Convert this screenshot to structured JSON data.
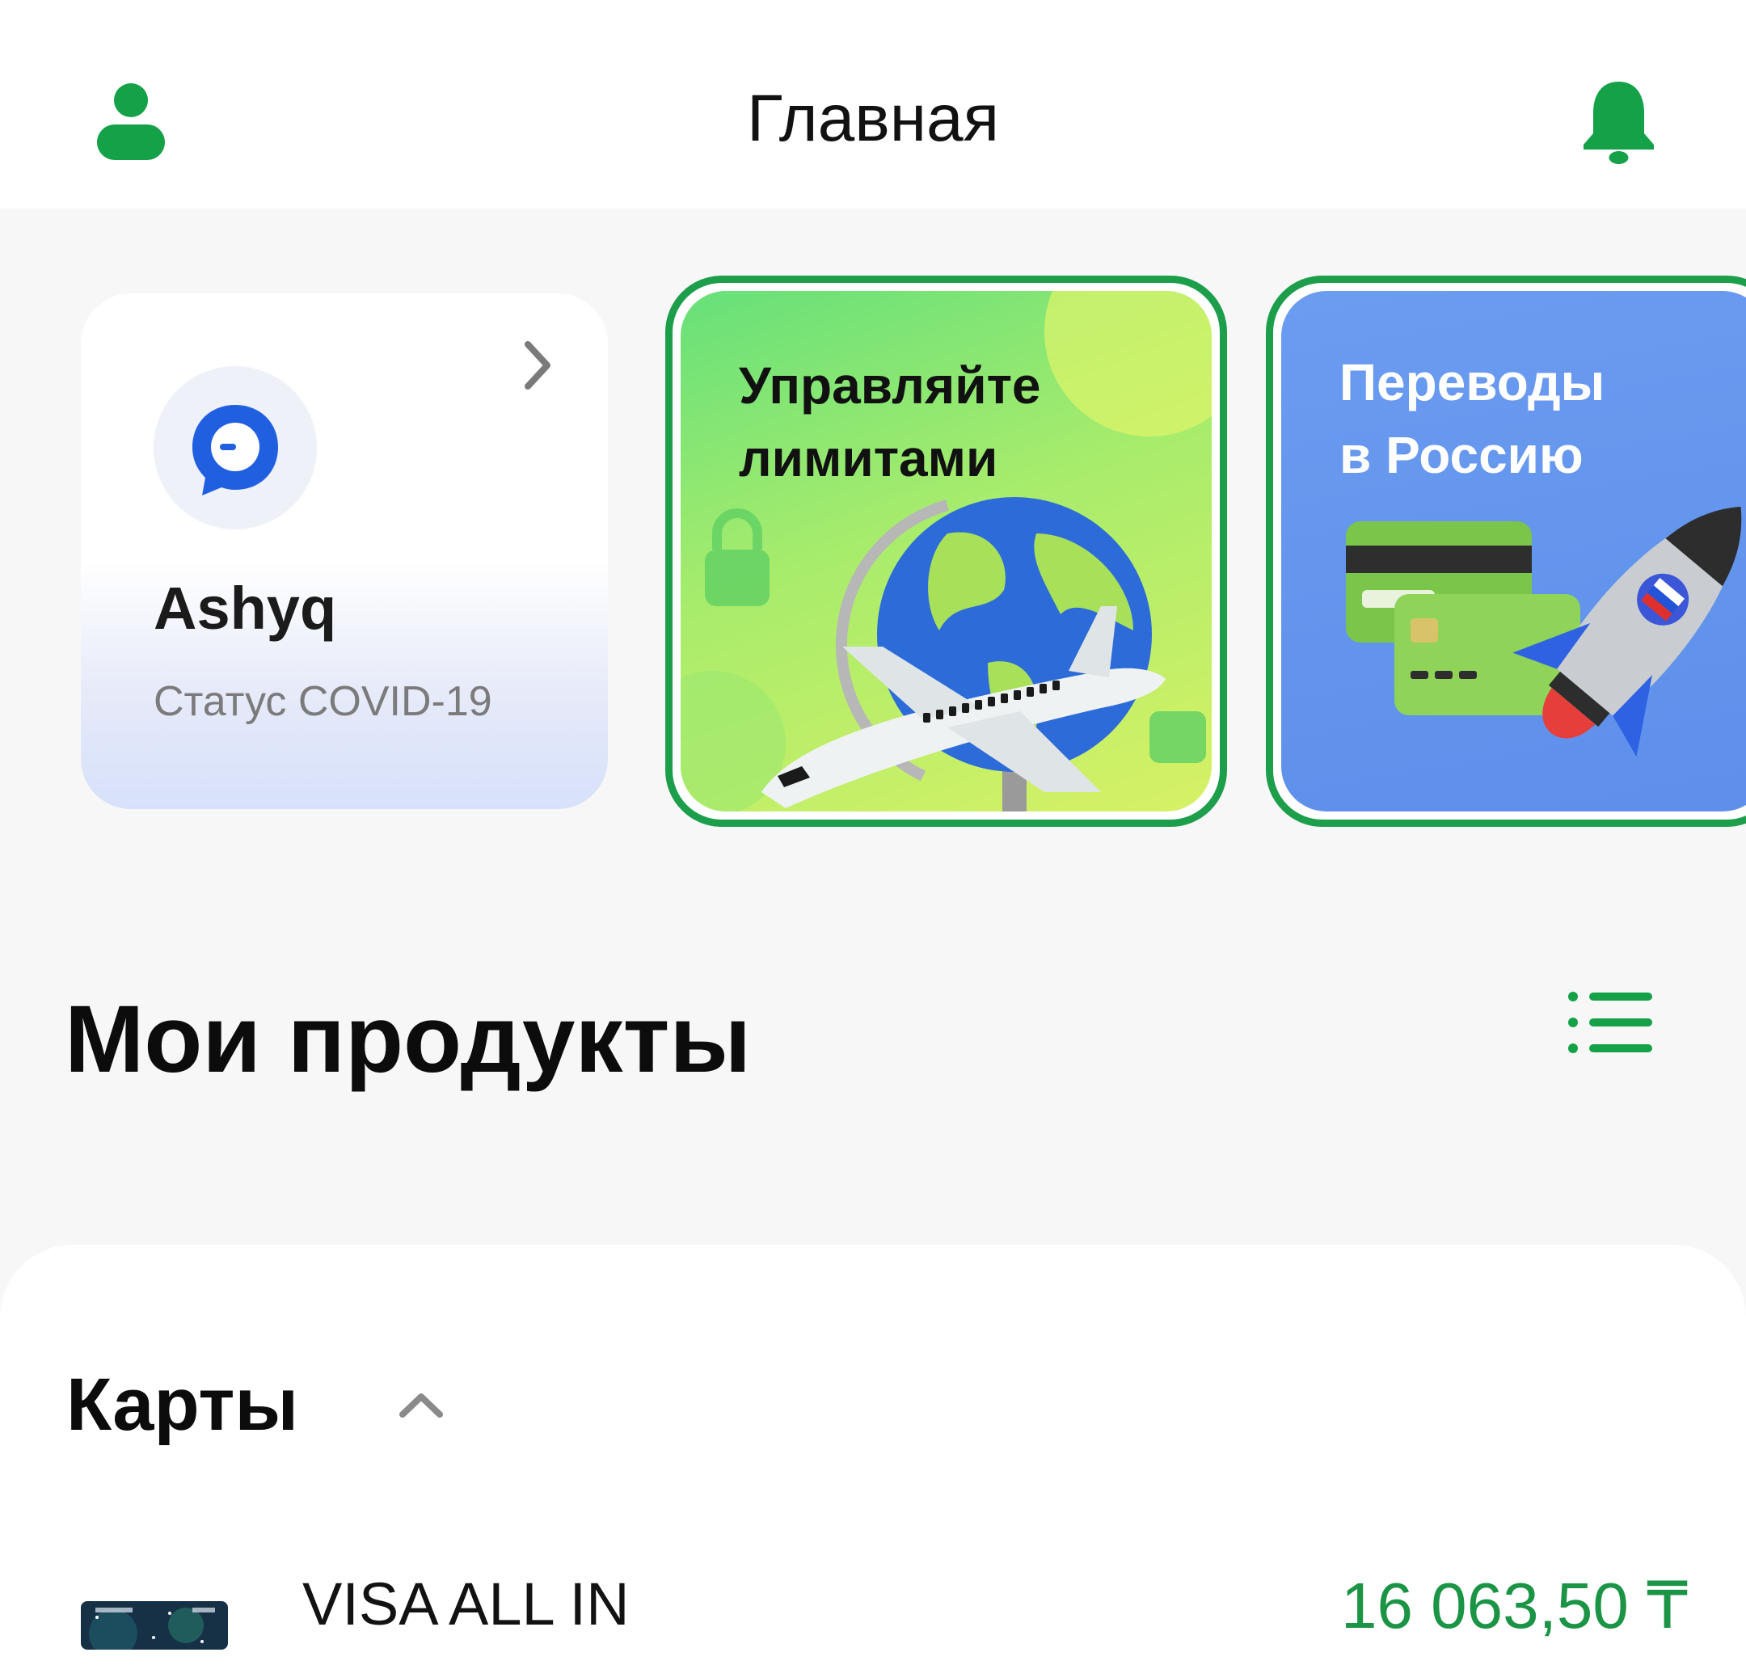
{
  "header": {
    "title": "Главная",
    "profile_icon": "profile-icon",
    "notification_icon": "bell-icon"
  },
  "stories": [
    {
      "title": "Ashyq",
      "subtitle": "Статус COVID-19",
      "icon": "chat-bubble-icon"
    },
    {
      "title": "Управляйте лимитами",
      "line1": "Управляйте",
      "line2": "лимитами",
      "image": "globe-airplane-illustration"
    },
    {
      "title": "Переводы в Россию",
      "line1": "Переводы",
      "line2": "в Россию",
      "image": "cards-rocket-illustration"
    }
  ],
  "products": {
    "title": "Мои продукты",
    "view_icon": "list-icon"
  },
  "cards": {
    "title": "Карты",
    "toggle_icon": "chevron-up-icon",
    "items": [
      {
        "name": "VISA ALL IN",
        "balance": "16 063,50 ₸"
      }
    ]
  },
  "colors": {
    "accent": "#1d9e4b",
    "balance": "#1b9446",
    "background": "#f7f7f7"
  }
}
